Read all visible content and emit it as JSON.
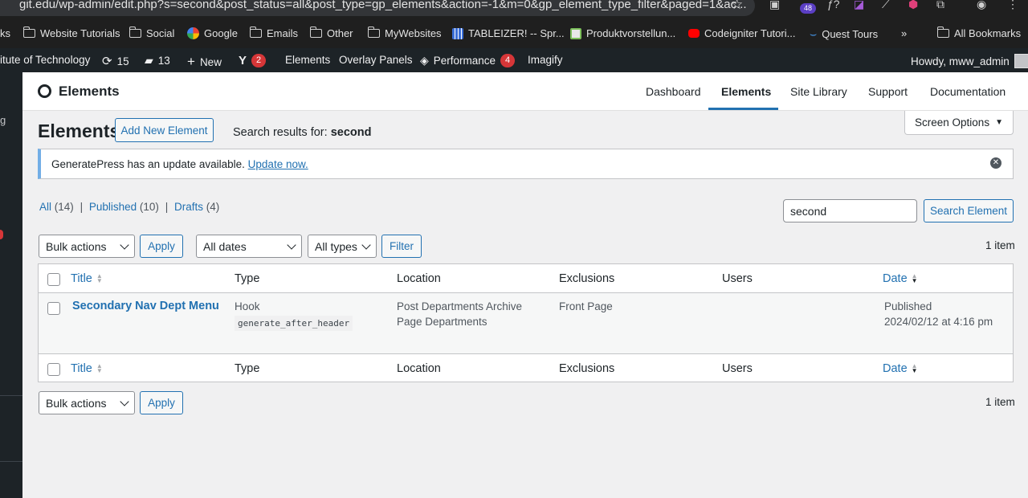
{
  "browser": {
    "url": "git.edu/wp-admin/edit.php?s=second&post_status=all&post_type=gp_elements&action=-1&m=0&gp_element_type_filter&paged=1&ac...",
    "extension_badge": "48",
    "bookmarks": [
      {
        "label": "ks",
        "icon": "none"
      },
      {
        "label": "Website Tutorials",
        "icon": "folder-icon"
      },
      {
        "label": "Social",
        "icon": "folder-icon"
      },
      {
        "label": "Google",
        "icon": "google-icon"
      },
      {
        "label": "Emails",
        "icon": "folder-icon"
      },
      {
        "label": "Other",
        "icon": "folder-icon"
      },
      {
        "label": "MyWebsites",
        "icon": "folder-icon"
      },
      {
        "label": "TABLEIZER! -- Spr...",
        "icon": "grid-icon"
      },
      {
        "label": "Produktvorstellun...",
        "icon": "page-icon"
      },
      {
        "label": "Codeigniter Tutori...",
        "icon": "youtube-icon"
      },
      {
        "label": "Quest Tours",
        "icon": "wave-icon"
      }
    ],
    "overflow": "»",
    "all_bookmarks": "All Bookmarks"
  },
  "adminbar": {
    "site": "itute of Technology",
    "updates": "15",
    "comments": "13",
    "new": "New",
    "yoast_count": "2",
    "elements": "Elements",
    "overlay": "Overlay Panels",
    "performance": "Performance",
    "performance_count": "4",
    "imagify": "Imagify",
    "howdy": "Howdy, mww_admin"
  },
  "sidebar": {
    "letter": "g"
  },
  "gp_header": {
    "title": "Elements",
    "nav": [
      "Dashboard",
      "Elements",
      "Site Library",
      "Support",
      "Documentation"
    ]
  },
  "screen_options": "Screen Options",
  "page": {
    "title": "Elements",
    "add_new": "Add New Element",
    "search_results_prefix": "Search results for: ",
    "search_term": "second"
  },
  "notice": {
    "text": "GeneratePress has an update available. ",
    "link": "Update now."
  },
  "filters": {
    "all": "All",
    "all_count": "(14)",
    "published": "Published",
    "published_count": "(10)",
    "drafts": "Drafts",
    "drafts_count": "(4)",
    "sep": "|"
  },
  "search": {
    "value": "second",
    "button": "Search Element"
  },
  "toolbar": {
    "bulk_actions": "Bulk actions",
    "apply": "Apply",
    "all_dates": "All dates",
    "all_types": "All types",
    "filter": "Filter",
    "count": "1 item"
  },
  "table": {
    "columns": [
      "Title",
      "Type",
      "Location",
      "Exclusions",
      "Users",
      "Date"
    ],
    "rows": [
      {
        "title": "Secondary Nav Dept Menu",
        "type": "Hook",
        "hook": "generate_after_header",
        "location_1": "Post Departments Archive",
        "location_2": "Page Departments",
        "exclusions": "Front Page",
        "users": "",
        "status": "Published",
        "date": "2024/02/12 at 4:16 pm"
      }
    ]
  }
}
